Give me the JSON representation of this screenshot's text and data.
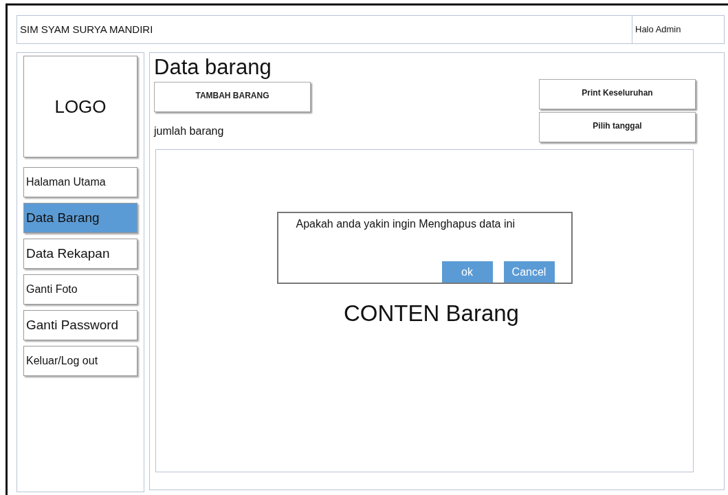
{
  "header": {
    "title": "SIM SYAM SURYA MANDIRI",
    "greeting": "Halo Admin"
  },
  "logo": "LOGO",
  "sidebar": {
    "items": [
      {
        "label": "Halaman Utama",
        "selected": false
      },
      {
        "label": "Data Barang",
        "selected": true
      },
      {
        "label": "Data Rekapan",
        "selected": false
      },
      {
        "label": "Ganti Foto",
        "selected": false
      },
      {
        "label": "Ganti Password",
        "selected": false
      },
      {
        "label": "Keluar/Log out",
        "selected": false
      }
    ]
  },
  "main": {
    "title": "Data barang",
    "add_button": "TAMBAH BARANG",
    "count_label": "jumlah barang",
    "print_button": "Print Keseluruhan",
    "date_button": "Pilih tanggal",
    "content_label": "CONTEN Barang"
  },
  "dialog": {
    "message": "Apakah  anda yakin ingin Menghapus data ini",
    "buttons": [
      "ok",
      "Cancel"
    ]
  }
}
